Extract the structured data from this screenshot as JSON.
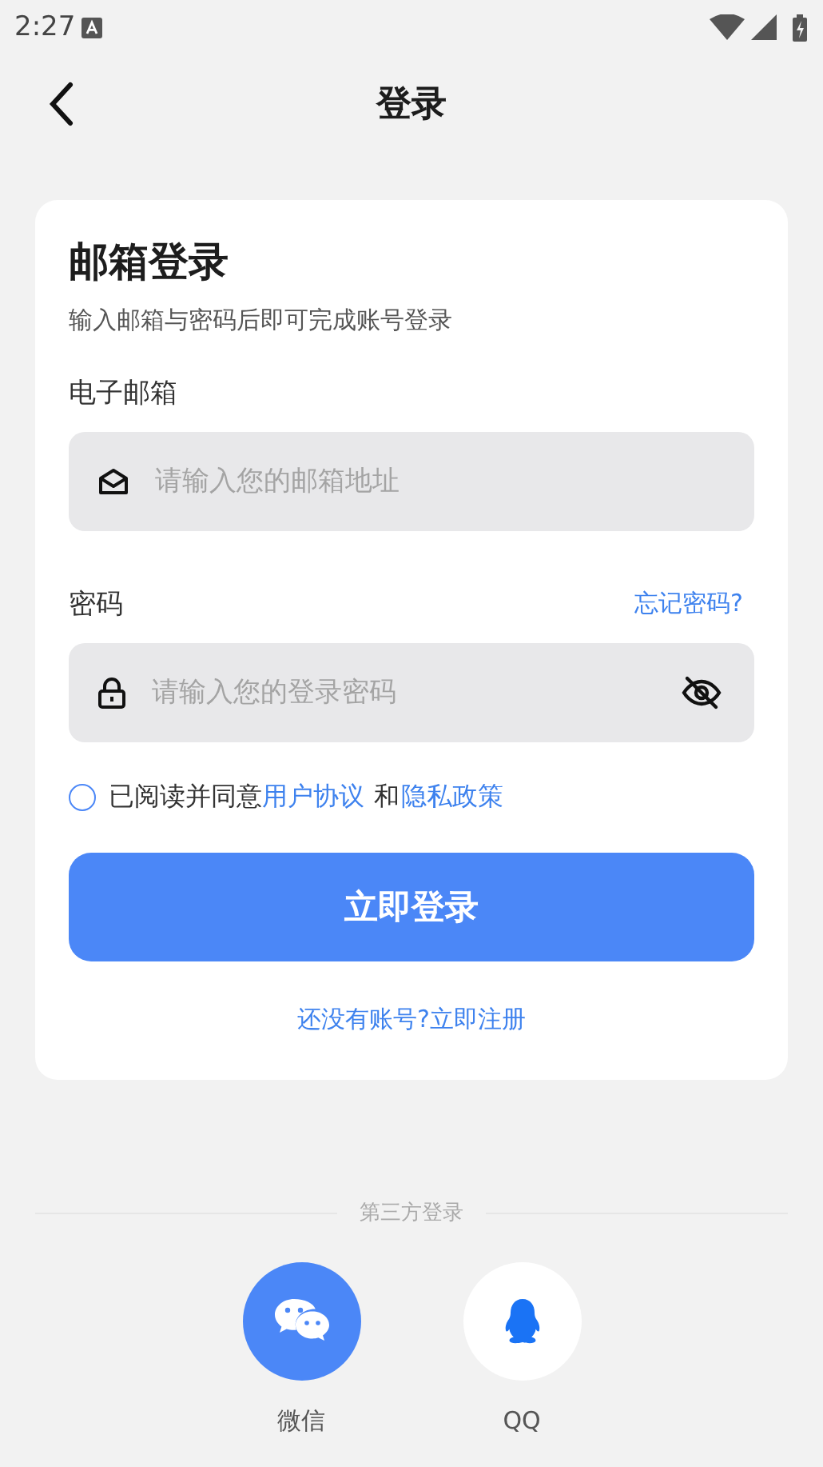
{
  "status_bar": {
    "time": "2:27"
  },
  "header": {
    "title": "登录"
  },
  "card": {
    "title": "邮箱登录",
    "subtitle": "输入邮箱与密码后即可完成账号登录",
    "email": {
      "label": "电子邮箱",
      "placeholder": "请输入您的邮箱地址"
    },
    "password": {
      "label": "密码",
      "forgot_link": "忘记密码?",
      "placeholder": "请输入您的登录密码",
      "visible": false
    },
    "agreement": {
      "checked": false,
      "text": "已阅读并同意",
      "terms_link": "用户协议",
      "joiner": "和",
      "privacy_link": "隐私政策"
    },
    "login_button": "立即登录",
    "register_link": "还没有账号?立即注册"
  },
  "third_party": {
    "title": "第三方登录",
    "providers": [
      {
        "kind": "wechat",
        "label": "微信"
      },
      {
        "kind": "qq",
        "label": "QQ"
      }
    ]
  }
}
